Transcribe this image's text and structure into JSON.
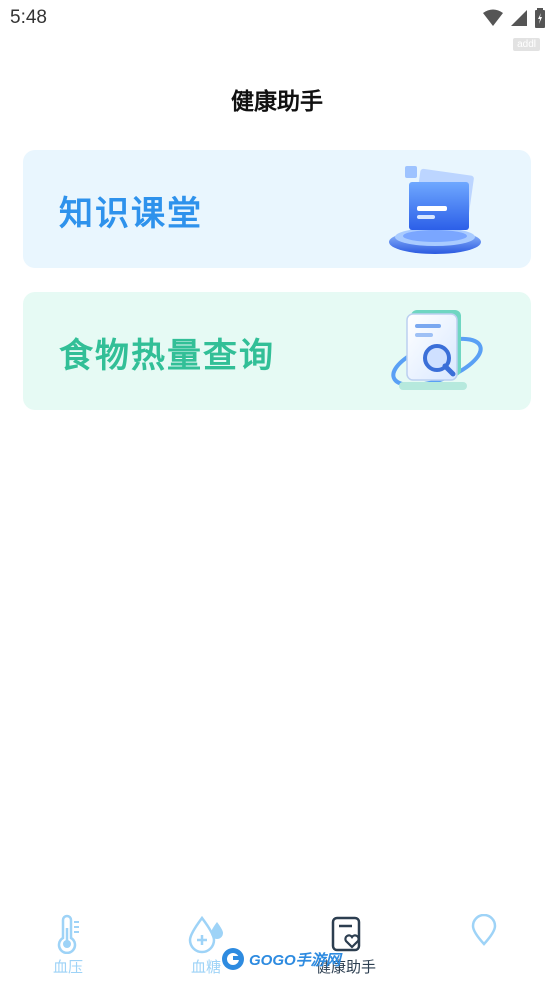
{
  "status_bar": {
    "time": "5:48",
    "icons": [
      "wifi-icon",
      "signal-icon",
      "battery-icon"
    ],
    "tag": "addl"
  },
  "header": {
    "title": "健康助手"
  },
  "cards": [
    {
      "label": "知识课堂",
      "icon": "documents-illustration-icon",
      "bg_color": "#e9f6fe",
      "text_color": "#2e92ec"
    },
    {
      "label": "食物热量查询",
      "icon": "document-search-illustration-icon",
      "bg_color": "#e6faf4",
      "text_color": "#32bf97"
    }
  ],
  "bottom_nav": {
    "items": [
      {
        "label": "血压",
        "icon": "thermometer-icon",
        "active": false
      },
      {
        "label": "血糖",
        "icon": "drop-plus-icon",
        "active": false
      },
      {
        "label": "健康助手",
        "icon": "doc-heart-icon",
        "active": true
      },
      {
        "label": "",
        "icon": "location-pin-icon",
        "active": false
      }
    ],
    "active_color": "#2c3e50",
    "inactive_color": "#9ed3f7"
  },
  "watermark": {
    "text": "GOGO手游网"
  }
}
